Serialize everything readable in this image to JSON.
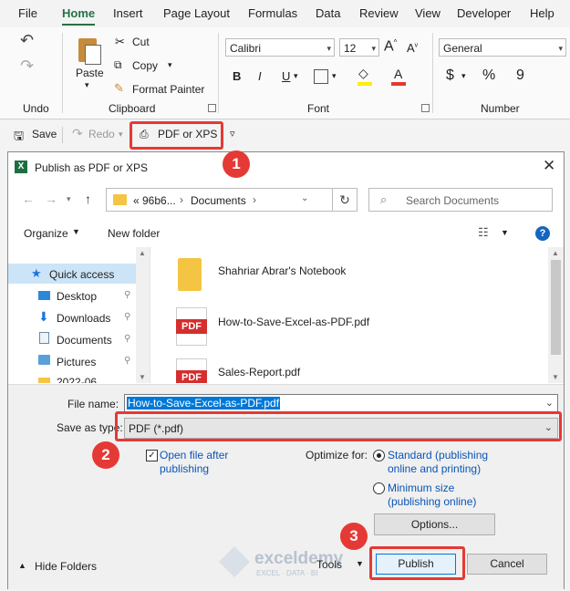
{
  "menu": [
    "File",
    "Home",
    "Insert",
    "Page Layout",
    "Formulas",
    "Data",
    "Review",
    "View",
    "Developer",
    "Help"
  ],
  "ribbon": {
    "undo_group": "Undo",
    "clipboard": {
      "paste": "Paste",
      "cut": "Cut",
      "copy": "Copy",
      "format_painter": "Format Painter",
      "label": "Clipboard"
    },
    "font": {
      "name": "Calibri",
      "size": "12",
      "label": "Font",
      "bold": "B",
      "italic": "I",
      "underline": "U"
    },
    "number": {
      "format": "General",
      "label": "Number",
      "currency": "$",
      "percent": "%",
      "comma": "9"
    }
  },
  "qat": {
    "save": "Save",
    "redo": "Redo",
    "pdf": "PDF or XPS"
  },
  "dialog": {
    "title": "Publish as PDF or XPS",
    "path": [
      "«  96b6...",
      "Documents"
    ],
    "search_placeholder": "Search Documents",
    "organize": "Organize",
    "new_folder": "New folder",
    "nav": [
      "Quick access",
      "Desktop",
      "Downloads",
      "Documents",
      "Pictures",
      "2022-06"
    ],
    "files": [
      "Shahriar Abrar's Notebook",
      "How-to-Save-Excel-as-PDF.pdf",
      "Sales-Report.pdf"
    ],
    "pdf_icon_text": "PDF",
    "file_name_label": "File name:",
    "file_name_value": "How-to-Save-Excel-as-PDF.pdf",
    "save_type_label": "Save as type:",
    "save_type_value": "PDF (*.pdf)",
    "open_after_l1": "Open file after",
    "open_after_l2": "publishing",
    "optimize_label": "Optimize for:",
    "standard_l1": "Standard (publishing",
    "standard_l2": "online and printing)",
    "minimum_l1": "Minimum size",
    "minimum_l2": "(publishing online)",
    "options": "Options...",
    "hide_folders": "Hide Folders",
    "tools": "Tools",
    "publish": "Publish",
    "cancel": "Cancel",
    "watermark_name": "exceldemy",
    "watermark_sub": "EXCEL · DATA · BI"
  },
  "badges": [
    "1",
    "2",
    "3"
  ],
  "colors": {
    "accent": "#217346",
    "badge": "#e53935",
    "link": "#0a55b4",
    "excel": "#1d6f42"
  }
}
